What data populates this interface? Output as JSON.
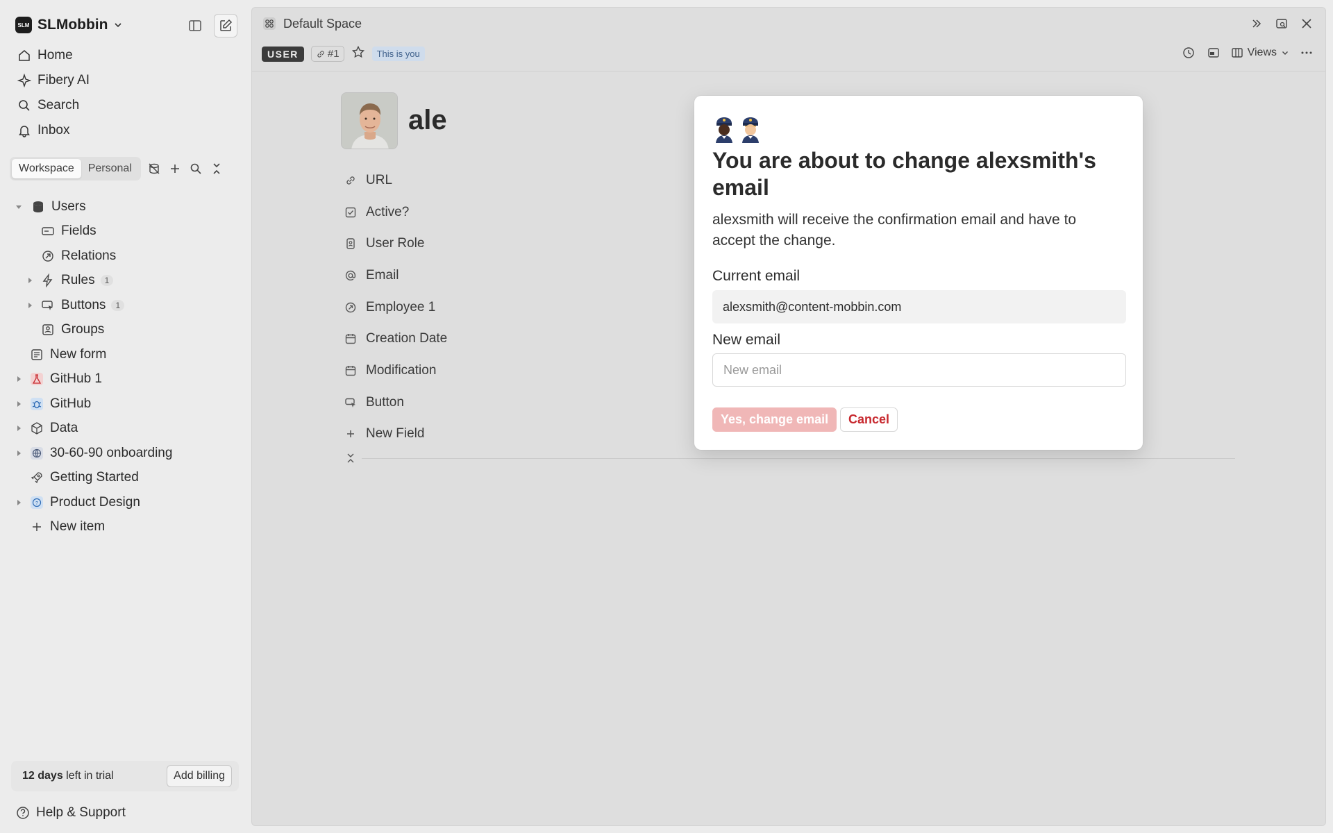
{
  "workspace": {
    "logo_text": "SLM",
    "name": "SLMobbin"
  },
  "nav": [
    {
      "label": "Home",
      "icon": "home-icon"
    },
    {
      "label": "Fibery AI",
      "icon": "sparkle-icon"
    },
    {
      "label": "Search",
      "icon": "search-icon"
    },
    {
      "label": "Inbox",
      "icon": "bell-icon"
    }
  ],
  "tabs": {
    "workspace": "Workspace",
    "personal": "Personal"
  },
  "tree": {
    "users": "Users",
    "fields": "Fields",
    "relations": "Relations",
    "rules": "Rules",
    "rules_count": "1",
    "buttons": "Buttons",
    "buttons_count": "1",
    "groups": "Groups",
    "new_form": "New form",
    "github1": "GitHub 1",
    "github": "GitHub",
    "data": "Data",
    "onboarding": "30-60-90 onboarding",
    "getting_started": "Getting Started",
    "product_design": "Product Design",
    "new_item": "New item"
  },
  "trial": {
    "days": "12 days",
    "suffix": " left in trial",
    "button": "Add billing"
  },
  "help": "Help & Support",
  "breadcrumb": "Default Space",
  "meta": {
    "type_badge": "USER",
    "id_badge": "#1",
    "you_badge": "This is you",
    "views": "Views"
  },
  "entity": {
    "title_partial": "ale"
  },
  "fields": [
    {
      "label": "URL",
      "icon": "link-icon"
    },
    {
      "label": "Active?",
      "icon": "checkbox-icon"
    },
    {
      "label": "User Role",
      "icon": "badge-icon"
    },
    {
      "label": "Email",
      "icon": "at-icon"
    },
    {
      "label": "Employee 1",
      "icon": "relation-icon"
    },
    {
      "label": "Creation Date",
      "icon": "calendar-icon"
    },
    {
      "label": "Modification",
      "icon": "calendar-icon"
    },
    {
      "label": "Button",
      "icon": "cursor-icon"
    },
    {
      "label": "New Field",
      "icon": "plus-icon"
    }
  ],
  "modal": {
    "title": "You are about to change alexsmith's email",
    "description": "alexsmith will receive the confirmation email and have to accept the change.",
    "current_label": "Current email",
    "current_value": "alexsmith@content-mobbin.com",
    "new_label": "New email",
    "new_placeholder": "New email",
    "confirm": "Yes, change email",
    "cancel": "Cancel"
  },
  "colors": {
    "accent_red": "#c7282e",
    "confirm_disabled": "#f0b7b7",
    "user_badge": "#3b3b3b",
    "you_badge": "#cfdcec"
  }
}
